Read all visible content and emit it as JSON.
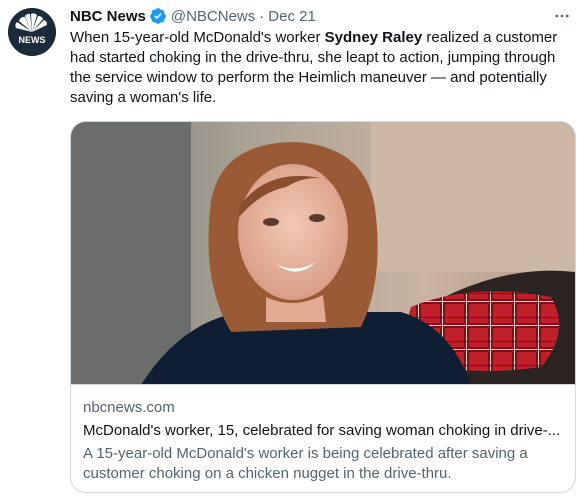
{
  "author": {
    "name": "NBC News",
    "handle": "@NBCNews",
    "separator": "·",
    "date": "Dec 21",
    "avatar_icon": "nbc-peacock-icon",
    "avatar_label": "NEWS",
    "verified_icon": "verified-badge-icon"
  },
  "tweet": {
    "text_part1": "When 15-year-old McDonald's worker ",
    "text_bold": "Sydney Raley",
    "text_part2": " realized a customer had started choking in the drive-thru, she leapt to action, jumping through the service window to perform the Heimlich maneuver — and potentially saving a woman's life."
  },
  "card": {
    "domain": "nbcnews.com",
    "title": "McDonald's worker, 15, celebrated for saving woman choking in drive-...",
    "description": "A 15-year-old McDonald's worker is being celebrated after saving a customer choking on a chicken nugget in the drive-thru."
  },
  "more_icon": "more-options-icon",
  "colors": {
    "verified": "#1d9bf0",
    "secondary_text": "#536471",
    "border": "#cfd9de"
  }
}
